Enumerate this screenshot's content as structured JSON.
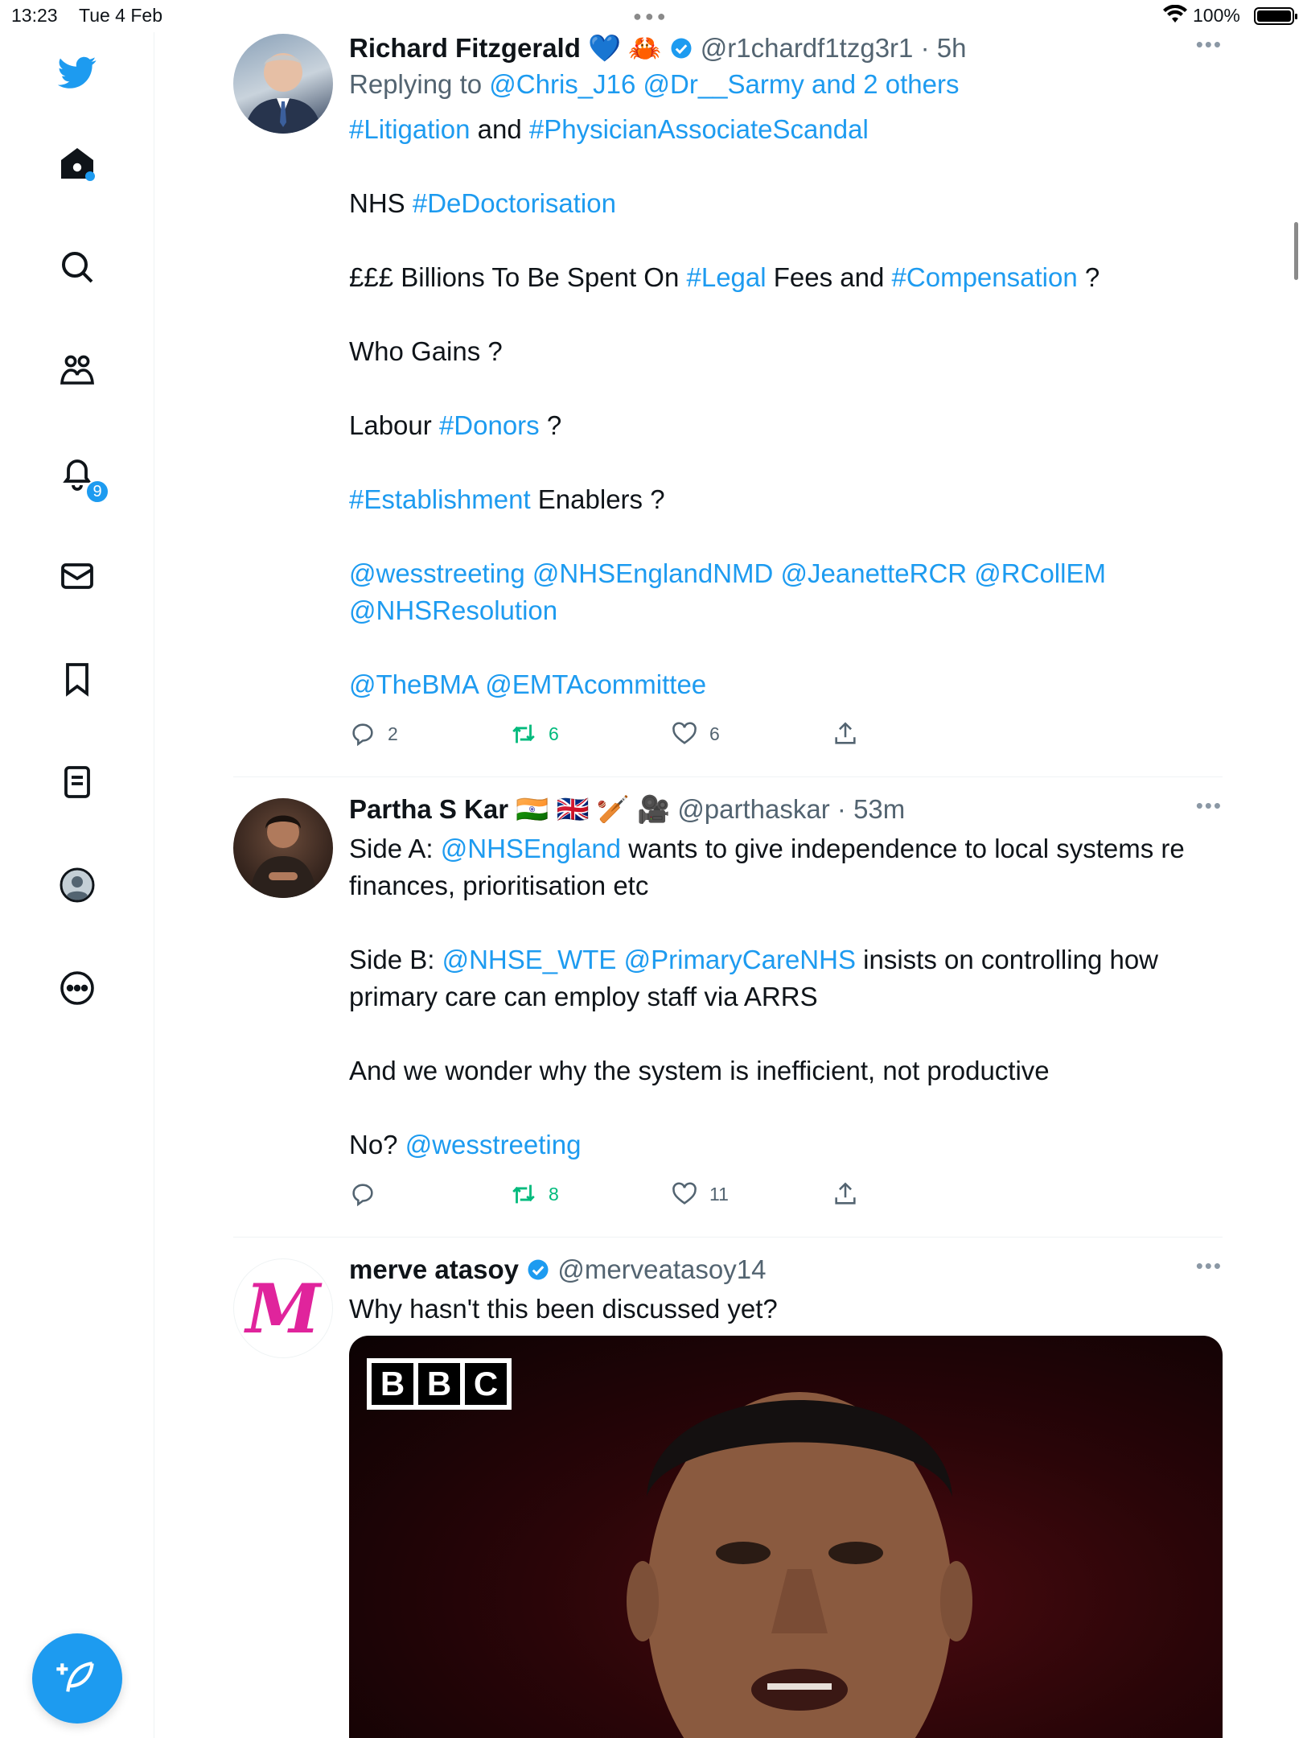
{
  "status": {
    "time": "13:23",
    "date": "Tue 4 Feb",
    "battery": "100%"
  },
  "sidebar": {
    "notifications_badge": "9",
    "items": [
      "twitter-logo-icon",
      "home-icon",
      "search-icon",
      "communities-icon",
      "notifications-icon",
      "messages-icon",
      "bookmarks-icon",
      "lists-icon",
      "profile-icon",
      "more-icon"
    ]
  },
  "tweets": [
    {
      "name": "Richard Fitzgerald",
      "emojis": "💙 🦀",
      "handle": "@r1chardf1tzg3r1",
      "time": "· 5h",
      "reply_prefix": "Replying to ",
      "reply_to": "@Chris_J16 @Dr__Sarmy and 2 others",
      "lines": {
        "l1a": "#Litigation",
        "l1b": " and ",
        "l1c": "#PhysicianAssociateScandal",
        "l2a": "NHS ",
        "l2b": "#DeDoctorisation",
        "l3a": "£££ Billions To Be Spent On ",
        "l3b": "#Legal",
        "l3c": " Fees and ",
        "l3d": "#Compensation",
        "l3e": " ?",
        "l4": "Who Gains ?",
        "l5a": "Labour ",
        "l5b": "#Donors",
        "l5c": " ?",
        "l6a": "#Establishment",
        "l6b": " Enablers ?",
        "l7": "@wesstreeting @NHSEnglandNMD @JeanetteRCR @RCollEM @NHSResolution",
        "l8": "@TheBMA @EMTAcommittee"
      },
      "replies": "2",
      "retweets": "6",
      "likes": "6"
    },
    {
      "name": "Partha S Kar",
      "emojis": "🇮🇳 🇬🇧 🏏 🎥",
      "handle": "@parthaskar",
      "time": "· 53m",
      "lines": {
        "p1a": "Side A: ",
        "p1b": "@NHSEngland",
        "p1c": " wants to give independence to local systems re finances, prioritisation etc",
        "p2a": "Side B: ",
        "p2b": "@NHSE_WTE",
        "p2c": " ",
        "p2d": "@PrimaryCareNHS",
        "p2e": " insists on controlling how primary care can employ staff via ARRS",
        "p3": "And we wonder why the system is inefficient, not productive",
        "p4a": "No? ",
        "p4b": "@wesstreeting"
      },
      "replies": "",
      "retweets": "8",
      "likes": "11"
    },
    {
      "name": "merve atasoy",
      "handle": "@merveatasoy14",
      "text": "Why hasn't this been discussed yet?",
      "media_logo": [
        "B",
        "B",
        "C"
      ],
      "avatar_letter": "M"
    }
  ],
  "colors": {
    "accent": "#1d9bf0",
    "retweet": "#00ba7c",
    "muted": "#536471"
  }
}
